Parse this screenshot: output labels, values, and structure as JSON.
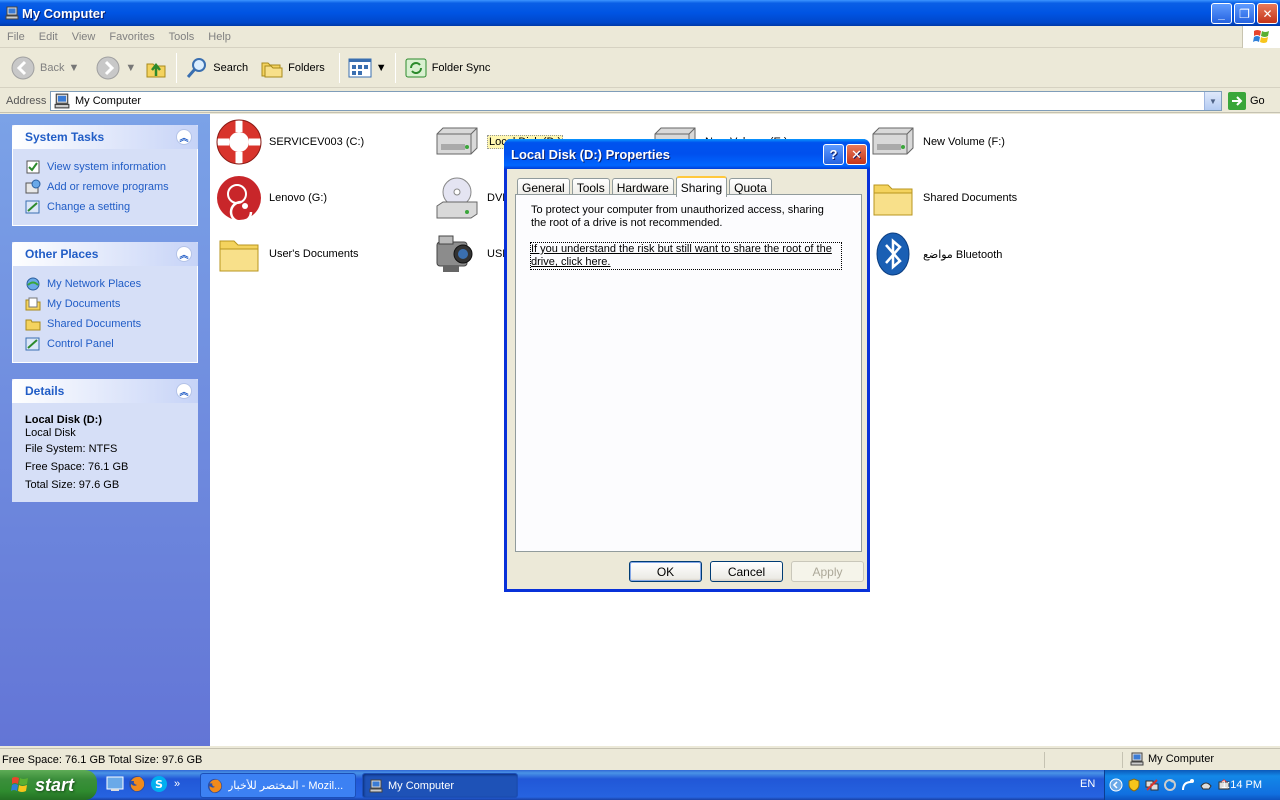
{
  "window": {
    "title": "My Computer",
    "icon": "my-computer-icon"
  },
  "menu": [
    "File",
    "Edit",
    "View",
    "Favorites",
    "Tools",
    "Help"
  ],
  "toolbar": {
    "back": "Back",
    "search": "Search",
    "folders": "Folders",
    "folder_sync": "Folder Sync"
  },
  "address": {
    "label": "Address",
    "value": "My Computer",
    "go": "Go"
  },
  "left": {
    "system_tasks": {
      "title": "System Tasks",
      "items": [
        "View system information",
        "Add or remove programs",
        "Change a setting"
      ]
    },
    "other_places": {
      "title": "Other Places",
      "items": [
        "My Network Places",
        "My Documents",
        "Shared Documents",
        "Control Panel"
      ]
    },
    "details": {
      "title": "Details",
      "name": "Local Disk (D:)",
      "type": "Local Disk",
      "file_system": "File System: NTFS",
      "free_space": "Free Space: 76.1 GB",
      "total_size": "Total Size: 97.6 GB"
    }
  },
  "items": {
    "c": "SERVICEV003 (C:)",
    "d": "Local Disk (D:)",
    "e": "New Volume (E:)",
    "f": "New Volume (F:)",
    "g": "Lenovo (G:)",
    "dvd": "DVD",
    "shared": "Shared Documents",
    "users": "User's Documents",
    "usb": "USB",
    "bluetooth": "مواضع Bluetooth"
  },
  "status": {
    "left": "Free Space: 76.1 GB Total Size: 97.6 GB",
    "right": "My Computer"
  },
  "taskbar": {
    "start": "start",
    "tasks": [
      "المختصر للأخبار - Mozil...",
      "My Computer"
    ],
    "lang": "EN",
    "clock": "1:14 PM"
  },
  "dialog": {
    "title": "Local Disk (D:) Properties",
    "tabs": [
      "General",
      "Tools",
      "Hardware",
      "Sharing",
      "Quota"
    ],
    "active_tab": "Sharing",
    "warning": "To protect your computer from unauthorized access, sharing the root of a drive is not recommended.",
    "link": "If you understand the risk but still want to share the root of the drive, click here.",
    "ok": "OK",
    "cancel": "Cancel",
    "apply": "Apply"
  },
  "colors": {
    "xp_blue": "#0054E3",
    "task_link": "#215DC6",
    "start_green": "#3C8F3C"
  }
}
